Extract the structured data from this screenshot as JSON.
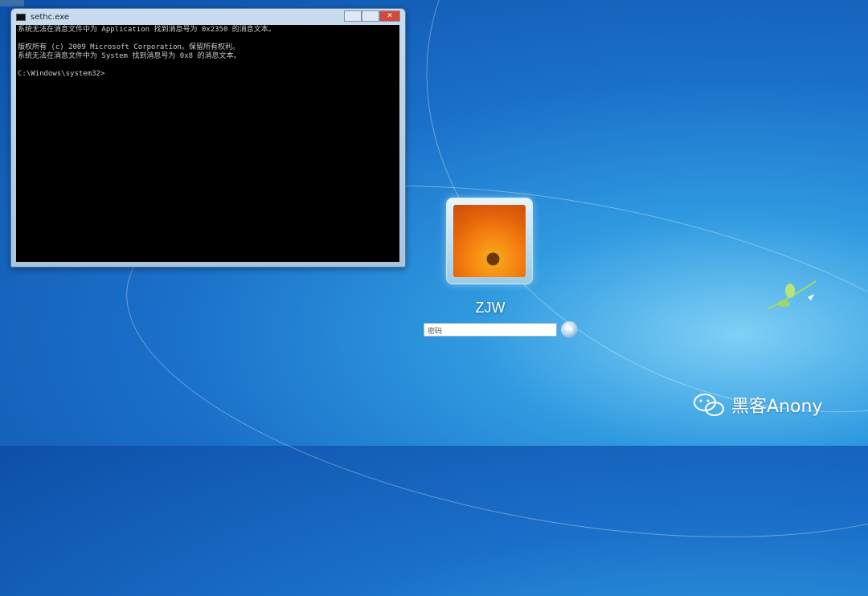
{
  "cmd_window": {
    "title": "sethc.exe",
    "lines": [
      "系统无法在消息文件中为 Application 找到消息号为 0x2350 的消息文本。",
      "",
      "版权所有 (c) 2009 Microsoft Corporation。保留所有权利。",
      "系统无法在消息文件中为 System 找到消息号为 0x8 的消息文本。",
      "",
      "C:\\Windows\\system32>"
    ]
  },
  "login": {
    "username": "ZJW",
    "password_placeholder": "密码"
  },
  "watermark": {
    "text": "黑客Anony"
  }
}
